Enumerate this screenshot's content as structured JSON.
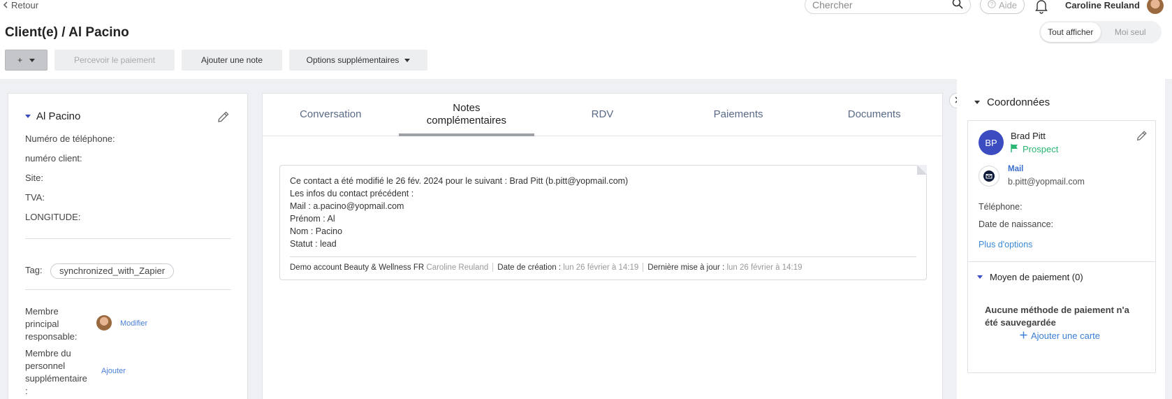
{
  "header": {
    "back_label": "Retour",
    "page_title": "Client(e) / Al Pacino",
    "search_placeholder": "Chercher",
    "help_label": "Aide",
    "user_name": "Caroline Reuland",
    "view_toggle": {
      "all": "Tout afficher",
      "solo": "Moi seul",
      "active": "all"
    }
  },
  "toolbar": {
    "plus_label": "+",
    "collect_payment_label": "Percevoir le paiement",
    "add_note_label": "Ajouter une note",
    "more_options_label": "Options supplémentaires"
  },
  "client": {
    "name": "Al Pacino",
    "fields": [
      "Numéro de téléphone:",
      "numéro client:",
      "Site:",
      "TVA:",
      "LONGITUDE:"
    ],
    "tag_label": "Tag:",
    "tag": "synchronized_with_Zapier",
    "main_member_label": [
      "Membre",
      "principal",
      "responsable:"
    ],
    "main_member_action": "Modifier",
    "extra_staff_label": [
      "Membre du",
      "personnel",
      "supplémentaire",
      ":"
    ],
    "extra_staff_action": "Ajouter"
  },
  "tabs": [
    {
      "label": "Conversation"
    },
    {
      "label": "Notes complémentaires"
    },
    {
      "label": "RDV"
    },
    {
      "label": "Paiements"
    },
    {
      "label": "Documents"
    }
  ],
  "active_tab": "Notes complémentaires",
  "note": {
    "lines": [
      "Ce contact a été modifié le 26 fév. 2024 pour le suivant : Brad Pitt (b.pitt@yopmail.com)",
      "Les infos du contact précédent :",
      "Mail : a.pacino@yopmail.com",
      "Prénom : Al",
      "Nom : Pacino",
      "Statut : lead"
    ],
    "account": "Demo account Beauty & Wellness FR",
    "author": "Caroline Reuland",
    "created_label": "Date de création :",
    "created_value": "lun 26 février à 14:19",
    "updated_label": "Dernière mise à jour :",
    "updated_value": "lun 26 février à 14:19"
  },
  "contact_panel": {
    "title": "Coordonnées",
    "initials": "BP",
    "name": "Brad Pitt",
    "status": "Prospect",
    "mail_label": "Mail",
    "mail_value": "b.pitt@yopmail.com",
    "phone_label": "Téléphone:",
    "birth_label": "Date de naissance:",
    "more_options": "Plus d'options",
    "payment_title": "Moyen de paiement (0)",
    "payment_empty": "Aucune méthode de paiement n'a été sauvegardée",
    "add_card": "Ajouter une carte"
  },
  "colors": {
    "accent": "#3a4cc0",
    "prospect": "#2bb673",
    "link": "#3a8ad6"
  }
}
